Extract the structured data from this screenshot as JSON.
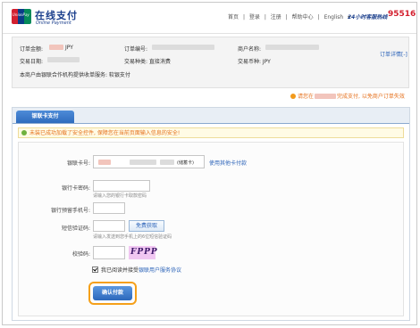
{
  "brand": {
    "logo_text": "UnionPay",
    "name_cn": "在线支付",
    "name_en": "Online Payment"
  },
  "topnav": {
    "items": [
      "首页",
      "|",
      "登录",
      "|",
      "注册",
      "|",
      "帮助中心",
      "|",
      "English",
      "▾"
    ],
    "hotline_label": "24小时客服热线",
    "hotline_number": "95516"
  },
  "order": {
    "amount_label": "订单金额:",
    "amount_currency": "JPY",
    "order_no_label": "订单编号:",
    "merchant_label": "商户名称:",
    "details_link": "订单详情[-]",
    "date_label": "交易日期:",
    "type_label": "交易种类: 直接消费",
    "currency_label": "交易币种: JPY",
    "service_note": "本商户由银联合作机构提供收单服务: 软银支付"
  },
  "warning": {
    "prefix": "请您在",
    "suffix": "完成支付, 以免商户订单失效"
  },
  "tabs": {
    "active": "银联卡支付"
  },
  "security_notice": "未装已成功加载了安全控件, 保障您在当前页面输入信息的安全!",
  "form": {
    "card_label": "银联卡号:",
    "card_tag": "(储蓄卡)",
    "card_link": "使用其他卡付款",
    "pin_label": "银行卡密码:",
    "pin_hint": "请输入您的银行卡取款密码",
    "phone_label": "银行预留手机号:",
    "sms_label": "短信验证码:",
    "sms_button": "免费获取",
    "sms_hint": "请输入发送到您手机上的6位短信验证码",
    "captcha_label": "校验码:",
    "captcha_text": "FPPP",
    "agree_text": "我已阅读并接受",
    "agree_link": "银联用户服务协议",
    "submit_label": "确认付款"
  },
  "colors": {
    "accent_blue": "#2f6cbd",
    "warning_orange": "#e5701c",
    "highlight_ring": "#f5a01a",
    "brand_red": "#d3202f"
  }
}
